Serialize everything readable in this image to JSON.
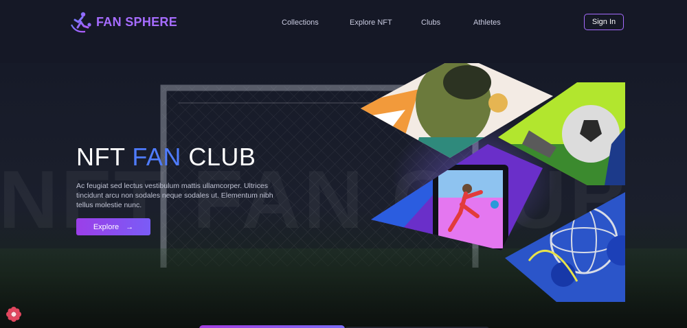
{
  "brand": {
    "name": "FAN SPHERE",
    "accent_color": "#a66cff",
    "logo_icon": "soccer-player-icon"
  },
  "nav": [
    {
      "label": "Collections"
    },
    {
      "label": "Explore NFT"
    },
    {
      "label": "Clubs"
    },
    {
      "label": "Athletes"
    }
  ],
  "header": {
    "signin_label": "Sign In"
  },
  "hero": {
    "title_part1": "NFT",
    "title_accent": "FAN",
    "title_part2": "CLUB",
    "background_word": "NFT FAN CLUB",
    "description": "Ac feugiat sed lectus vestibulum mattis ullamcorper. Ultrices tincidunt arcu non sodales neque sodales ut. Elementum nibh tellus molestie nunc.",
    "explore_label": "Explore",
    "explore_icon": "arrow-right-icon",
    "title_accent_color": "#4f7cff"
  },
  "collage": {
    "cards": [
      {
        "subject": "footballer-portrait"
      },
      {
        "subject": "soccer-ball-kick"
      },
      {
        "subject": "jumping-player"
      },
      {
        "subject": "sphere-sculpture"
      }
    ]
  },
  "corner_icon": "flower-badge-icon"
}
